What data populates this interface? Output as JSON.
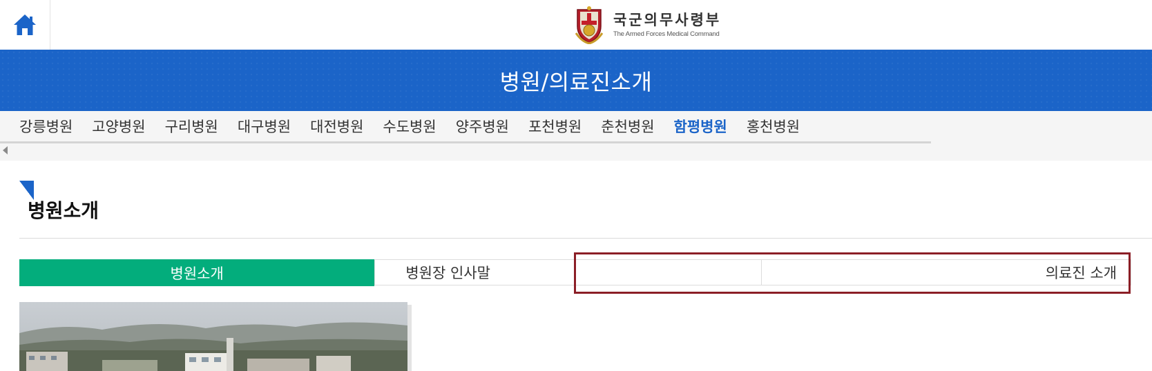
{
  "header": {
    "home_icon": "home-icon",
    "logo_title_ko": "국군의무사령부",
    "logo_title_en": "The Armed Forces Medical Command"
  },
  "banner": {
    "title": "병원/의료진소개"
  },
  "hospital_tabs": [
    {
      "label": "강릉병원",
      "active": false
    },
    {
      "label": "고양병원",
      "active": false
    },
    {
      "label": "구리병원",
      "active": false
    },
    {
      "label": "대구병원",
      "active": false
    },
    {
      "label": "대전병원",
      "active": false
    },
    {
      "label": "수도병원",
      "active": false
    },
    {
      "label": "양주병원",
      "active": false
    },
    {
      "label": "포천병원",
      "active": false
    },
    {
      "label": "춘천병원",
      "active": false
    },
    {
      "label": "함평병원",
      "active": true
    },
    {
      "label": "홍천병원",
      "active": false
    }
  ],
  "section": {
    "title": "병원소개"
  },
  "sub_tabs": [
    {
      "label": "병원소개",
      "active": true
    },
    {
      "label": "병원장 인사말",
      "active": false
    },
    {
      "label": "의료진 소개",
      "active": false
    }
  ],
  "colors": {
    "brand_blue": "#1b64c8",
    "active_green": "#03ad7c",
    "highlight_red": "#8b1e26"
  }
}
